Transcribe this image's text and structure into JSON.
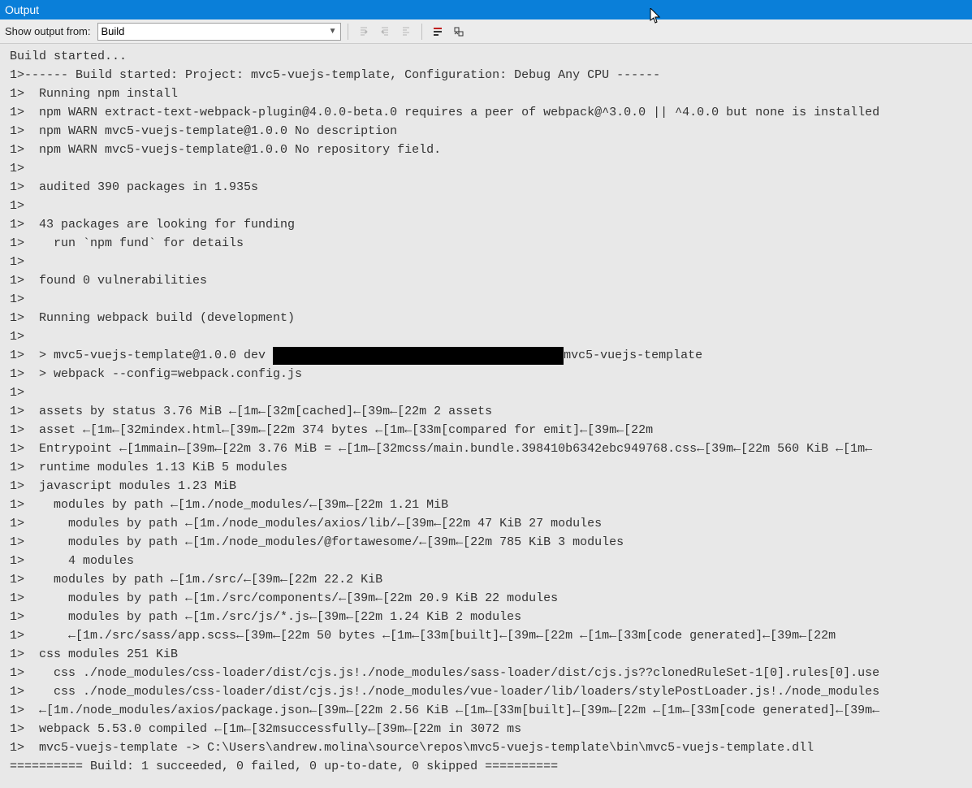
{
  "titlebar": {
    "title": "Output"
  },
  "toolbar": {
    "label": "Show output from:",
    "source_selected": "Build",
    "buttons": {
      "indent_left": "indent-left",
      "outdent": "outdent",
      "indent_right": "indent-right",
      "wordwrap": "word-wrap",
      "clear": "clear-all"
    }
  },
  "output": {
    "lines": [
      "Build started...",
      "1>------ Build started: Project: mvc5-vuejs-template, Configuration: Debug Any CPU ------",
      "1>  Running npm install",
      "1>  npm WARN extract-text-webpack-plugin@4.0.0-beta.0 requires a peer of webpack@^3.0.0 || ^4.0.0 but none is installed",
      "1>  npm WARN mvc5-vuejs-template@1.0.0 No description",
      "1>  npm WARN mvc5-vuejs-template@1.0.0 No repository field.",
      "1>",
      "1>  audited 390 packages in 1.935s",
      "1>",
      "1>  43 packages are looking for funding",
      "1>    run `npm fund` for details",
      "1>",
      "1>  found 0 vulnerabilities",
      "1>",
      "1>  Running webpack build (development)",
      "1>",
      "1>  > mvc5-vuejs-template@1.0.0 dev [[REDACTED]]mvc5-vuejs-template",
      "1>  > webpack --config=webpack.config.js",
      "1>",
      "1>  assets by status 3.76 MiB ←[1m←[32m[cached]←[39m←[22m 2 assets",
      "1>  asset ←[1m←[32mindex.html←[39m←[22m 374 bytes ←[1m←[33m[compared for emit]←[39m←[22m",
      "1>  Entrypoint ←[1mmain←[39m←[22m 3.76 MiB = ←[1m←[32mcss/main.bundle.398410b6342ebc949768.css←[39m←[22m 560 KiB ←[1m←",
      "1>  runtime modules 1.13 KiB 5 modules",
      "1>  javascript modules 1.23 MiB",
      "1>    modules by path ←[1m./node_modules/←[39m←[22m 1.21 MiB",
      "1>      modules by path ←[1m./node_modules/axios/lib/←[39m←[22m 47 KiB 27 modules",
      "1>      modules by path ←[1m./node_modules/@fortawesome/←[39m←[22m 785 KiB 3 modules",
      "1>      4 modules",
      "1>    modules by path ←[1m./src/←[39m←[22m 22.2 KiB",
      "1>      modules by path ←[1m./src/components/←[39m←[22m 20.9 KiB 22 modules",
      "1>      modules by path ←[1m./src/js/*.js←[39m←[22m 1.24 KiB 2 modules",
      "1>      ←[1m./src/sass/app.scss←[39m←[22m 50 bytes ←[1m←[33m[built]←[39m←[22m ←[1m←[33m[code generated]←[39m←[22m",
      "1>  css modules 251 KiB",
      "1>    css ./node_modules/css-loader/dist/cjs.js!./node_modules/sass-loader/dist/cjs.js??clonedRuleSet-1[0].rules[0].use",
      "1>    css ./node_modules/css-loader/dist/cjs.js!./node_modules/vue-loader/lib/loaders/stylePostLoader.js!./node_modules",
      "1>  ←[1m./node_modules/axios/package.json←[39m←[22m 2.56 KiB ←[1m←[33m[built]←[39m←[22m ←[1m←[33m[code generated]←[39m←",
      "1>  webpack 5.53.0 compiled ←[1m←[32msuccessfully←[39m←[22m in 3072 ms",
      "1>  mvc5-vuejs-template -> C:\\Users\\andrew.molina\\source\\repos\\mvc5-vuejs-template\\bin\\mvc5-vuejs-template.dll",
      "========== Build: 1 succeeded, 0 failed, 0 up-to-date, 0 skipped =========="
    ]
  }
}
